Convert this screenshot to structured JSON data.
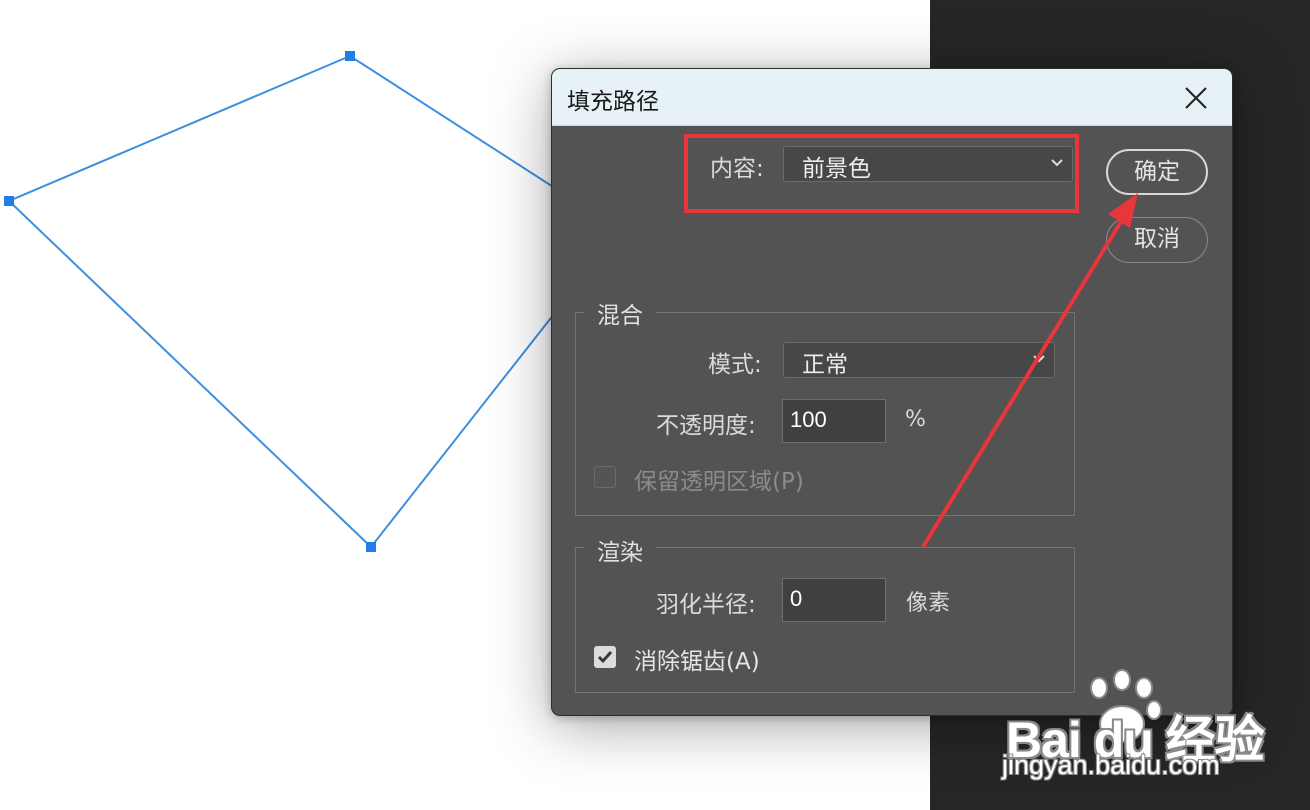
{
  "colors": {
    "path_stroke": "#3d8fe0",
    "anchor_fill": "#1f7fe6",
    "annotation_red": "#e8363a",
    "dialog_bg": "#535353",
    "titlebar_bg": "#e6f2f6",
    "dark_panel": "#262626"
  },
  "dialog": {
    "title": "填充路径",
    "close_icon": "close-icon",
    "contents": {
      "label": "内容:",
      "value": "前景色"
    },
    "buttons": {
      "ok": "确定",
      "cancel": "取消"
    },
    "blending": {
      "title": "混合",
      "mode_label": "模式:",
      "mode_value": "正常",
      "opacity_label": "不透明度:",
      "opacity_value": "100",
      "opacity_unit": "%",
      "preserve_transparency": {
        "label": "保留透明区域(P)",
        "checked": false,
        "enabled": false
      }
    },
    "rendering": {
      "title": "渲染",
      "feather_label": "羽化半径:",
      "feather_value": "0",
      "feather_unit": "像素",
      "anti_alias": {
        "label": "消除锯齿(A)",
        "checked": true,
        "enabled": true
      }
    }
  },
  "watermark": {
    "brand": "Bai du 经验",
    "url": "jingyan.baidu.com"
  }
}
